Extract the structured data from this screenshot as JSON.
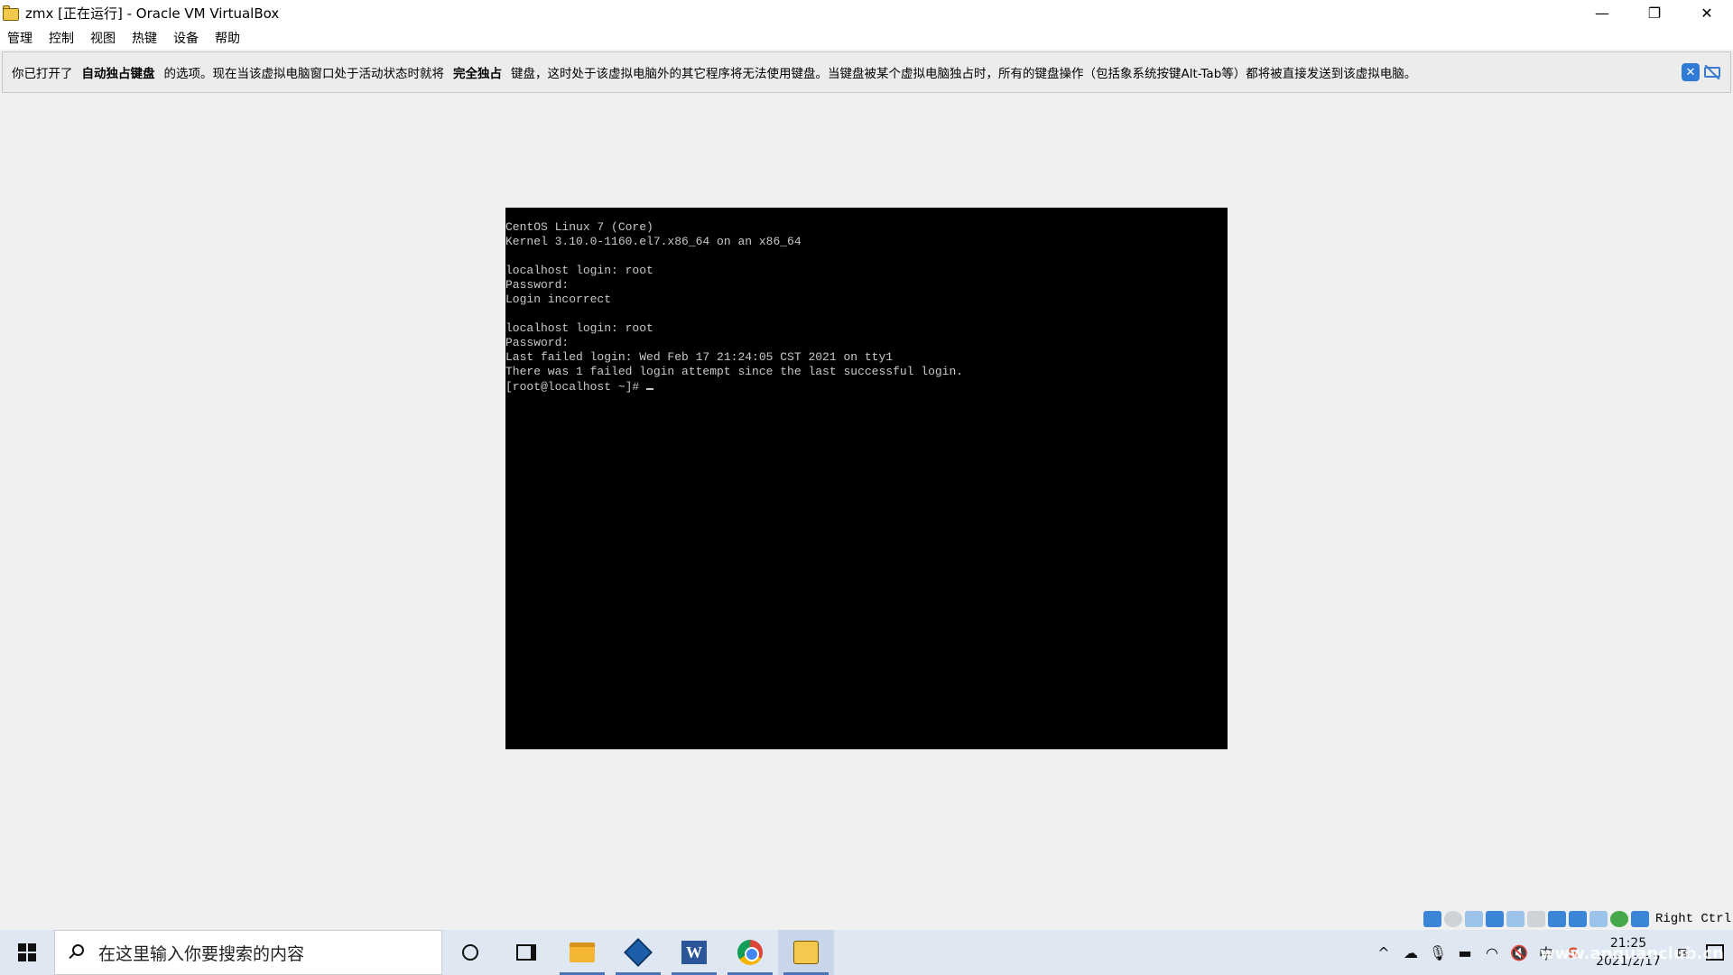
{
  "window": {
    "title": "zmx [正在运行] - Oracle VM VirtualBox",
    "minimize": "—",
    "restore": "❐",
    "close": "✕"
  },
  "menu": [
    "管理",
    "控制",
    "视图",
    "热键",
    "设备",
    "帮助"
  ],
  "banner": {
    "part1": "你已打开了",
    "bold1": "自动独占键盘",
    "part2": "的选项。现在当该虚拟电脑窗口处于活动状态时就将",
    "bold2": "完全独占",
    "part3": "键盘，这时处于该虚拟电脑外的其它程序将无法使用键盘。当键盘被某个虚拟电脑独占时，所有的键盘操作（包括象系统按键Alt-Tab等）都将被直接发送到该虚拟电脑。"
  },
  "terminal": {
    "lines": [
      "CentOS Linux 7 (Core)",
      "Kernel 3.10.0-1160.el7.x86_64 on an x86_64",
      "",
      "localhost login: root",
      "Password:",
      "Login incorrect",
      "",
      "localhost login: root",
      "Password:",
      "Last failed login: Wed Feb 17 21:24:05 CST 2021 on tty1",
      "There was 1 failed login attempt since the last successful login.",
      "[root@localhost ~]# "
    ]
  },
  "status_bar": {
    "host_key": "Right Ctrl"
  },
  "taskbar": {
    "search_placeholder": "在这里输入你要搜索的内容",
    "word_label": "W",
    "clock_time": "21:25",
    "clock_date": "2021/2/17",
    "ime": "中",
    "watermark": "www.anquanclub.cn"
  }
}
